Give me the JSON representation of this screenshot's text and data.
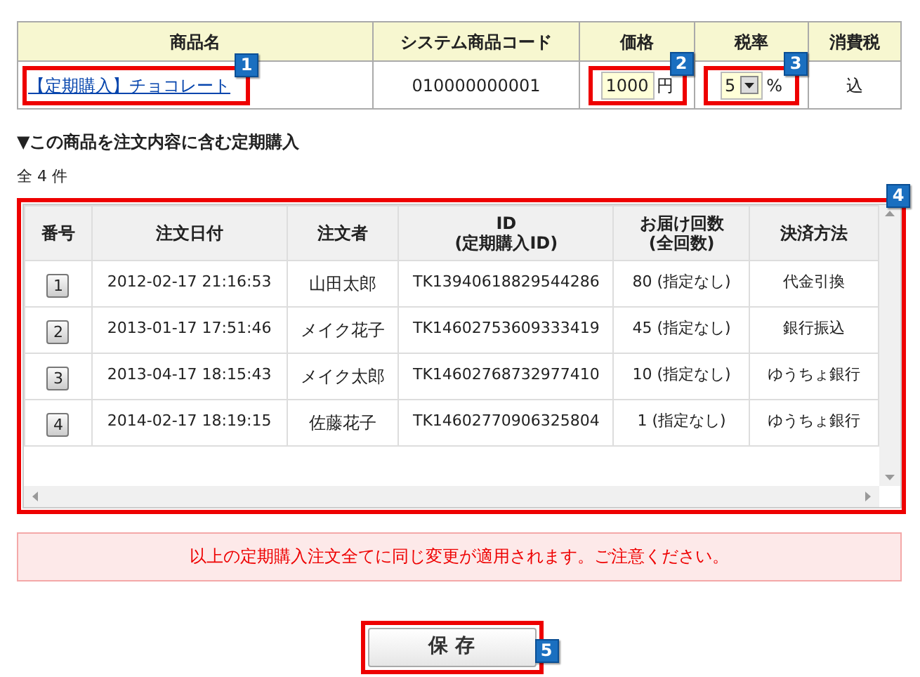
{
  "product_table": {
    "columns": [
      "商品名",
      "システム商品コード",
      "価格",
      "税率",
      "消費税"
    ],
    "row": {
      "name": "【定期購入】チョコレート",
      "name_callout": "1",
      "code": "010000000001",
      "price": "1000",
      "price_unit": "円",
      "price_callout": "2",
      "tax_rate": "5",
      "tax_rate_unit": "%",
      "tax_rate_callout": "3",
      "tax": "込"
    }
  },
  "section_heading": "▼この商品を注文内容に含む定期購入",
  "count": "全 4 件",
  "orders": {
    "callout": "4",
    "columns": [
      {
        "line1": "番号"
      },
      {
        "line1": "注文日付"
      },
      {
        "line1": "注文者"
      },
      {
        "line1": "ID",
        "line2": "(定期購入ID)"
      },
      {
        "line1": "お届け回数",
        "line2": "(全回数)"
      },
      {
        "line1": "決済方法"
      }
    ],
    "rows": [
      {
        "number": "1",
        "date": "2012-02-17 21:16:53",
        "customer": "山田太郎",
        "id": "TK13940618829544286",
        "deliveries": "80 (指定なし)",
        "payment": "代金引換"
      },
      {
        "number": "2",
        "date": "2013-01-17 17:51:46",
        "customer": "メイク花子",
        "id": "TK14602753609333419",
        "deliveries": "45 (指定なし)",
        "payment": "銀行振込"
      },
      {
        "number": "3",
        "date": "2013-04-17 18:15:43",
        "customer": "メイク太郎",
        "id": "TK14602768732977410",
        "deliveries": "10 (指定なし)",
        "payment": "ゆうちょ銀行"
      },
      {
        "number": "4",
        "date": "2014-02-17 18:19:15",
        "customer": "佐藤花子",
        "id": "TK14602770906325804",
        "deliveries": "1 (指定なし)",
        "payment": "ゆうちょ銀行"
      }
    ]
  },
  "notice": "以上の定期購入注文全てに同じ変更が適用されます。ご注意ください。",
  "save_button": {
    "label": "保 存",
    "callout": "5"
  }
}
